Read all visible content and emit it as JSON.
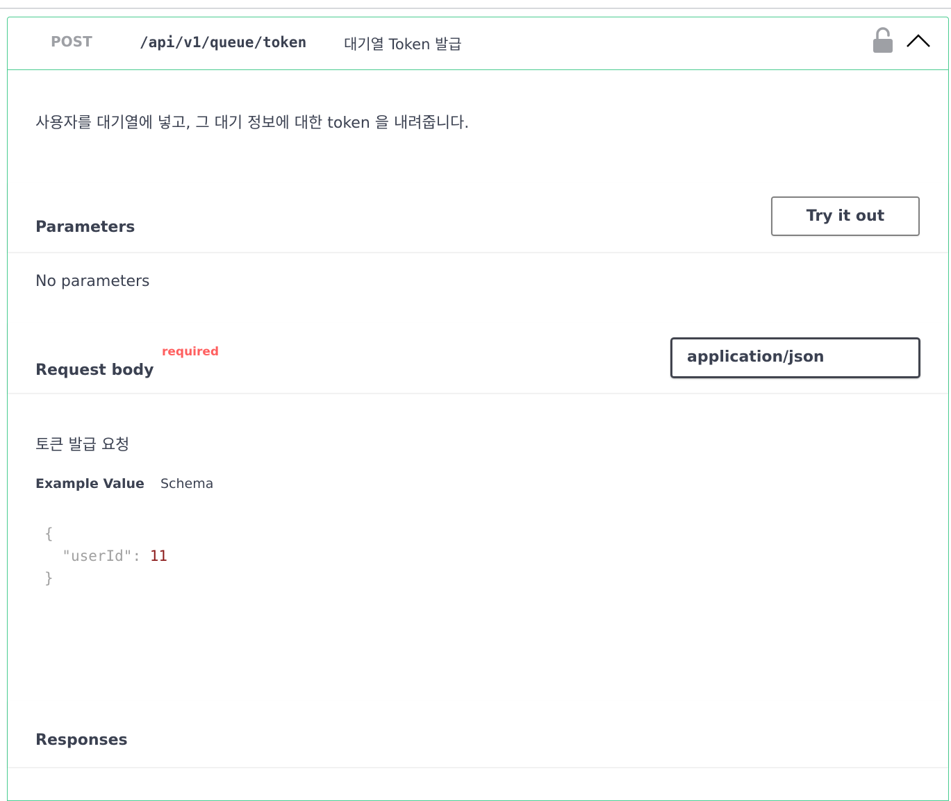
{
  "operation": {
    "method": "POST",
    "path": "/api/v1/queue/token",
    "summary": "대기열 Token 발급",
    "description": "사용자를 대기열에 넣고, 그 대기 정보에 대한 token 을 내려줍니다."
  },
  "parameters": {
    "title": "Parameters",
    "try_label": "Try it out",
    "empty_text": "No parameters"
  },
  "request_body": {
    "title": "Request body",
    "required_label": "required",
    "content_type": "application/json",
    "description": "토큰 발급 요청",
    "tabs": {
      "example": "Example Value",
      "schema": "Schema"
    },
    "example": {
      "open": "{",
      "key": "\"userId\"",
      "colon": ":",
      "value": "11",
      "close": "}"
    }
  },
  "responses": {
    "title": "Responses"
  },
  "colors": {
    "post_border": "#49cc90",
    "method_text": "#9ea0a5",
    "required": "#ff6060",
    "example_number": "#8b1a1a"
  },
  "icons": {
    "lock": "lock-icon",
    "collapse": "chevron-up-icon"
  }
}
